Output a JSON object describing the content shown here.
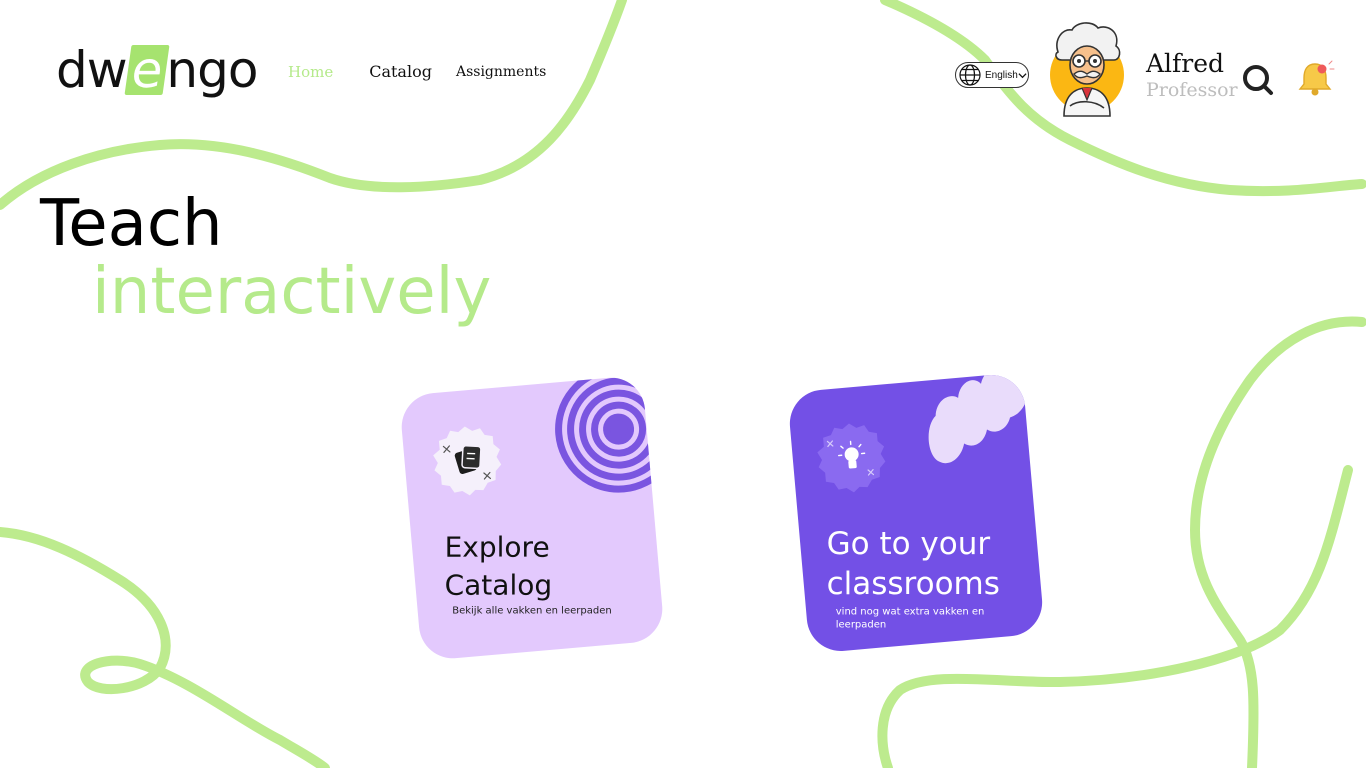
{
  "logo": {
    "pre": "dw",
    "accent": "e",
    "post": "ngo"
  },
  "nav": {
    "home": "Home",
    "catalog": "Catalog",
    "assignments": "Assignments"
  },
  "language": {
    "label": "English",
    "icon": "globe-icon",
    "chevron": "chevron-down-icon"
  },
  "user": {
    "name": "Alfred",
    "role": "Professor",
    "avatar": "professor-avatar"
  },
  "icons": {
    "search": "search-icon",
    "notifications": "bell-icon"
  },
  "hero": {
    "line1": "Teach",
    "line2": "interactively"
  },
  "cards": [
    {
      "title_line1": "Explore",
      "title_line2": "Catalog",
      "subtitle": "Bekijk alle vakken en leerpaden",
      "icon": "book-stack-icon"
    },
    {
      "title_line1": "Go to your",
      "title_line2": "classrooms",
      "subtitle": "vind nog wat extra vakken en leerpaden",
      "icon": "lightbulb-icon"
    }
  ],
  "colors": {
    "accent_green": "#b5ea8b",
    "squiggle_green": "#bdeb8e",
    "card_lilac": "#e3c9fd",
    "card_purple": "#7350e6",
    "deco_purple": "#7a55e0"
  }
}
